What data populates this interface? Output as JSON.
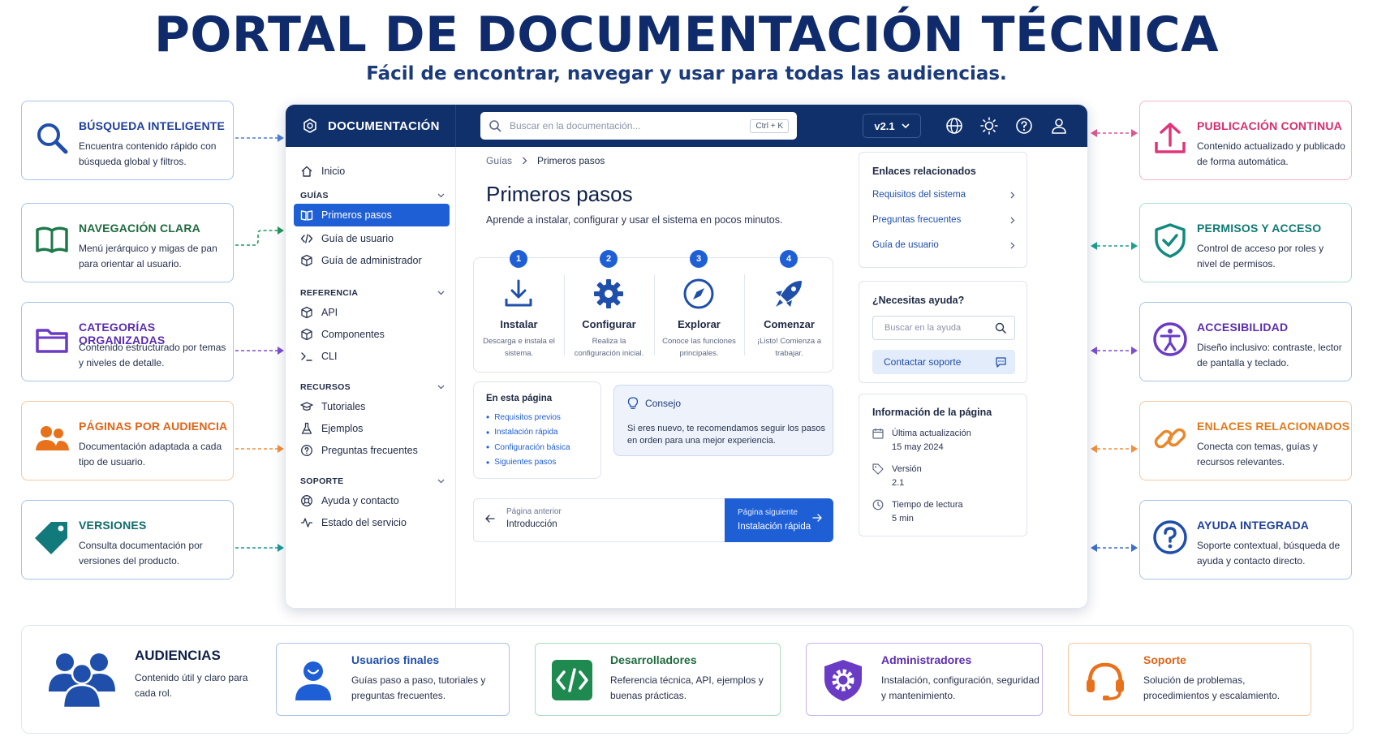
{
  "header": {
    "title": "PORTAL DE DOCUMENTACIÓN TÉCNICA",
    "subtitle": "Fácil de encontrar, navegar y usar para todas las audiencias."
  },
  "colors": {
    "navy": "#10306b",
    "primary": "#1f5fd6",
    "search": "#1f4faa",
    "navigation": "#1e7a4a",
    "categories": "#6a3bc4",
    "audience": "#e8721c",
    "versions": "#127a7a",
    "publishing": "#e0357a",
    "permissions": "#128a80",
    "accessibility": "#6a3bc4",
    "related": "#e8892c",
    "help": "#1f4faa"
  },
  "features_left": [
    {
      "icon": "search-icon",
      "title": "BÚSQUEDA INTELIGENTE",
      "desc": "Encuentra contenido rápido con búsqueda global y filtros."
    },
    {
      "icon": "book-icon",
      "title": "NAVEGACIÓN CLARA",
      "desc": "Menú jerárquico y migas de pan para orientar al usuario."
    },
    {
      "icon": "folder-icon",
      "title": "CATEGORÍAS ORGANIZADAS",
      "desc": "Contenido estructurado por temas y niveles de detalle."
    },
    {
      "icon": "users-icon",
      "title": "PÁGINAS POR AUDIENCIA",
      "desc": "Documentación adaptada a cada tipo de usuario."
    },
    {
      "icon": "tag-icon",
      "title": "VERSIONES",
      "desc": "Consulta documentación por versiones del producto."
    }
  ],
  "features_right": [
    {
      "icon": "upload-icon",
      "title": "PUBLICACIÓN CONTINUA",
      "desc": "Contenido actualizado y publicado de forma automática."
    },
    {
      "icon": "shield-check-icon",
      "title": "PERMISOS Y ACCESO",
      "desc": "Control de acceso por roles y nivel de permisos."
    },
    {
      "icon": "accessibility-icon",
      "title": "ACCESIBILIDAD",
      "desc": "Diseño inclusivo: contraste, lector de pantalla y teclado."
    },
    {
      "icon": "link-icon",
      "title": "ENLACES RELACIONADOS",
      "desc": "Conecta con temas, guías y recursos relevantes."
    },
    {
      "icon": "help-circle-icon",
      "title": "AYUDA INTEGRADA",
      "desc": "Soporte contextual, búsqueda de ayuda y contacto directo."
    }
  ],
  "app": {
    "brand": "DOCUMENTACIÓN",
    "search_placeholder": "Buscar en la documentación...",
    "search_shortcut": "Ctrl + K",
    "version": "v2.1",
    "sidebar": {
      "home": "Inicio",
      "sections": [
        {
          "label": "GUÍAS",
          "items": [
            "Primeros pasos",
            "Guía de usuario",
            "Guía de administrador"
          ]
        },
        {
          "label": "REFERENCIA",
          "items": [
            "API",
            "Componentes",
            "CLI"
          ]
        },
        {
          "label": "RECURSOS",
          "items": [
            "Tutoriales",
            "Ejemplos",
            "Preguntas frecuentes"
          ]
        },
        {
          "label": "SOPORTE",
          "items": [
            "Ayuda y contacto",
            "Estado del servicio"
          ]
        }
      ],
      "active": "Primeros pasos"
    },
    "breadcrumb": {
      "parent": "Guías",
      "current": "Primeros pasos"
    },
    "page_title": "Primeros pasos",
    "page_desc": "Aprende a instalar, configurar y usar el sistema en pocos minutos.",
    "steps": [
      {
        "num": "1",
        "icon": "download-icon",
        "title": "Instalar",
        "desc": "Descarga e instala el sistema."
      },
      {
        "num": "2",
        "icon": "gear-icon",
        "title": "Configurar",
        "desc": "Realiza la configuración inicial."
      },
      {
        "num": "3",
        "icon": "compass-icon",
        "title": "Explorar",
        "desc": "Conoce las funciones principales."
      },
      {
        "num": "4",
        "icon": "rocket-icon",
        "title": "Comenzar",
        "desc": "¡Listo! Comienza a trabajar."
      }
    ],
    "toc": {
      "title": "En esta página",
      "items": [
        "Requisitos previos",
        "Instalación rápida",
        "Configuración básica",
        "Siguientes pasos"
      ]
    },
    "tip": {
      "title": "Consejo",
      "text": "Si eres nuevo, te recomendamos seguir los pasos en orden para una mejor experiencia."
    },
    "pager": {
      "prev_label": "Página anterior",
      "prev_value": "Introducción",
      "next_label": "Página siguiente",
      "next_value": "Instalación rápida"
    },
    "related": {
      "title": "Enlaces relacionados",
      "links": [
        "Requisitos del sistema",
        "Preguntas frecuentes",
        "Guía de usuario"
      ]
    },
    "help": {
      "title": "¿Necesitas ayuda?",
      "search_placeholder": "Buscar en la ayuda",
      "contact": "Contactar soporte"
    },
    "page_info": {
      "title": "Información de la página",
      "updated_label": "Última actualización",
      "updated_value": "15 may 2024",
      "version_label": "Versión",
      "version_value": "2.1",
      "reading_label": "Tiempo de lectura",
      "reading_value": "5 min"
    }
  },
  "audiences": {
    "title": "AUDIENCIAS",
    "desc": "Contenido útil y claro para cada rol.",
    "cards": [
      {
        "icon": "user-icon",
        "title": "Usuarios finales",
        "desc": "Guías paso a paso, tutoriales y preguntas frecuentes."
      },
      {
        "icon": "code-icon",
        "title": "Desarrolladores",
        "desc": "Referencia técnica, API, ejemplos y buenas prácticas."
      },
      {
        "icon": "shield-gear-icon",
        "title": "Administradores",
        "desc": "Instalación, configuración, seguridad y mantenimiento."
      },
      {
        "icon": "headset-icon",
        "title": "Soporte",
        "desc": "Solución de problemas, procedimientos y escalamiento."
      }
    ]
  }
}
